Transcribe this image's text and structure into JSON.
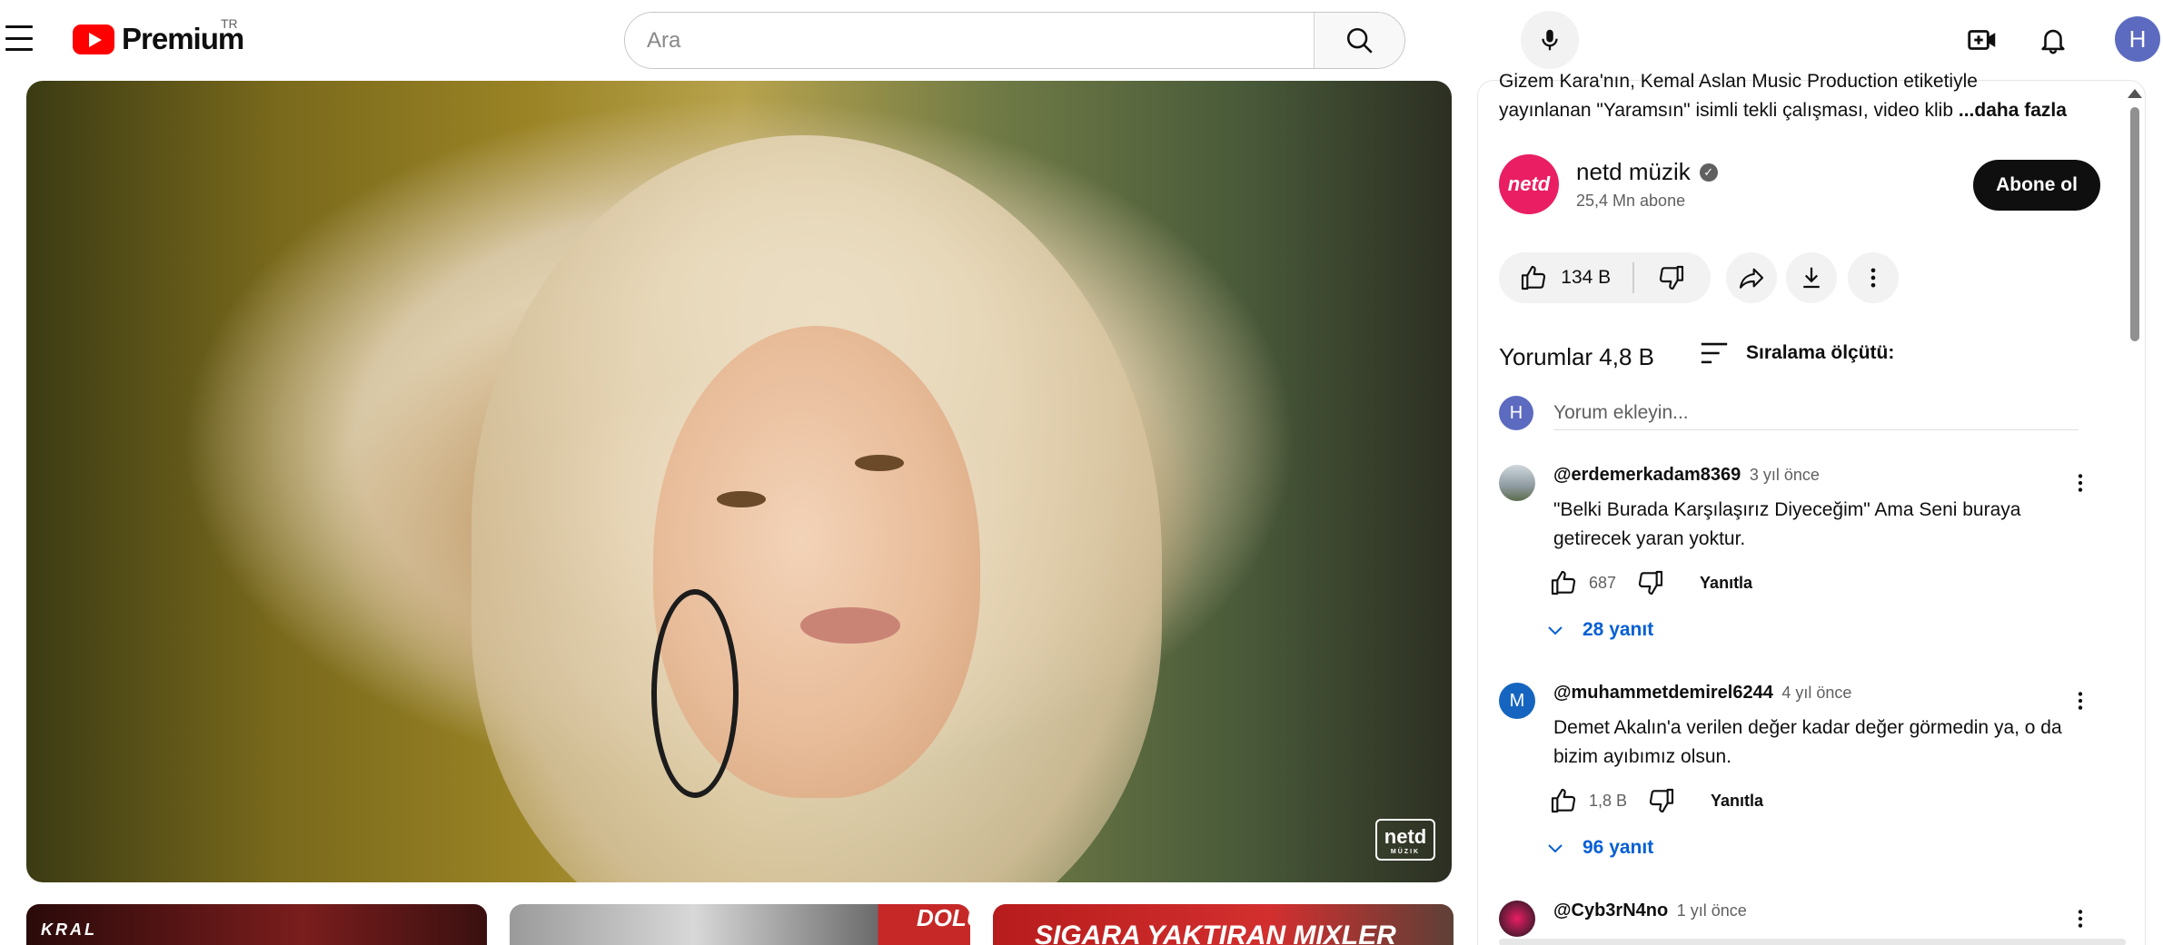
{
  "header": {
    "brand": "Premium",
    "region": "TR",
    "search_placeholder": "Ara",
    "avatar_letter": "H"
  },
  "video": {
    "watermark_logo": "netd",
    "watermark_sub": "MÜZIK"
  },
  "related": [
    {
      "text": "KRAL"
    },
    {
      "text": "DOLU"
    },
    {
      "text": "SIGARA YAKTIRAN MIXLER"
    }
  ],
  "description": {
    "line1": "Gizem Kara'nın, Kemal Aslan Music Production etiketiyle",
    "line2": "yayınlanan \"Yaramsın\" isimli tekli çalışması, video klib",
    "more": "...daha fazla"
  },
  "channel": {
    "logo_text": "netd",
    "name": "netd müzik",
    "verified": "✓",
    "subscribers": "25,4 Mn abone",
    "subscribe_label": "Abone ol"
  },
  "actions": {
    "likes": "134 B"
  },
  "comments": {
    "title": "Yorumlar 4,8 B",
    "sort_label": "Sıralama ölçütü:",
    "my_avatar": "H",
    "input_placeholder": "Yorum ekleyin...",
    "reply_label": "Yanıtla",
    "items": [
      {
        "user": "@erdemerkadam8369",
        "time": "3 yıl önce",
        "line1": "\"Belki Burada Karşılaşırız Diyeceğim\" Ama Seni buraya",
        "line2": "getirecek yaran yoktur.",
        "likes": "687",
        "replies": "28 yanıt",
        "avatar": ""
      },
      {
        "user": "@muhammetdemirel6244",
        "time": "4 yıl önce",
        "line1": "Demet Akalın'a verilen değer kadar değer görmedin ya, o da",
        "line2": "bizim ayıbımız olsun.",
        "likes": "1,8 B",
        "replies": "96 yanıt",
        "avatar": "M"
      },
      {
        "user": "@Cyb3rN4no",
        "time": "1 yıl önce",
        "avatar": ""
      }
    ]
  },
  "colors": {
    "accent_blue": "#065fd4",
    "brand_red": "#ff0000",
    "channel_pink": "#e91e63",
    "avatar_purple": "#5c6bc0"
  }
}
